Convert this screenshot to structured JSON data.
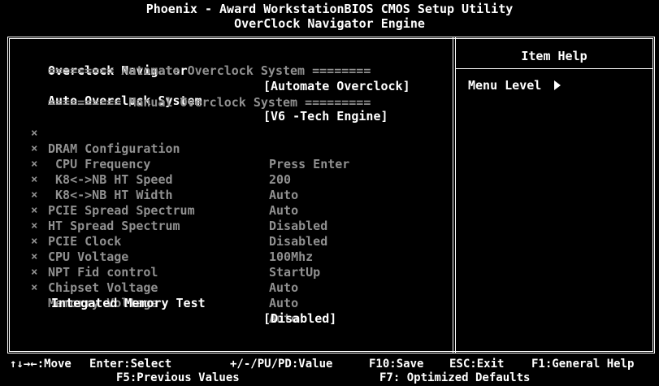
{
  "header": {
    "title": "Phoenix - Award WorkstationBIOS CMOS Setup Utility",
    "subtitle": "OverClock Navigator Engine"
  },
  "help": {
    "title": "Item Help",
    "menu_level": "Menu Level"
  },
  "menu": {
    "overclock_navigator": {
      "label": "Overclock Navigator",
      "value": "[Automate Overclock]"
    },
    "sep_auto": "========= Automate Overclock System ========",
    "auto_overclock": {
      "label": "Auto Overclock System",
      "value": "[V6 -Tech Engine]"
    },
    "sep_manual": "========== Manual Overclock System =========",
    "items": [
      {
        "label": "DRAM Configuration",
        "value": "Press Enter"
      },
      {
        "label": " CPU Frequency",
        "value": "200"
      },
      {
        "label": " K8<->NB HT Speed",
        "value": "Auto"
      },
      {
        "label": " K8<->NB HT Width",
        "value": "Auto"
      },
      {
        "label": "PCIE Spread Spectrum",
        "value": "Disabled"
      },
      {
        "label": "HT Spread Spectrum",
        "value": "Disabled"
      },
      {
        "label": "PCIE Clock",
        "value": "100Mhz"
      },
      {
        "label": "CPU Voltage",
        "value": "StartUp"
      },
      {
        "label": "NPT Fid control",
        "value": "Auto"
      },
      {
        "label": "Chipset Voltage",
        "value": "Auto"
      },
      {
        "label": "Memorry Voltage",
        "value": "Auto"
      }
    ],
    "disabled_mark": "×",
    "memory_test": {
      "label": "Integated Memory Test",
      "value": "[Disabled]"
    }
  },
  "footer": {
    "move": "↑↓→←:Move",
    "enter": "Enter:Select",
    "value": "+/-/PU/PD:Value",
    "save": "F10:Save",
    "exit": "ESC:Exit",
    "help": "F1:General Help",
    "previous": "F5:Previous Values",
    "optimized": "F7: Optimized Defaults"
  }
}
